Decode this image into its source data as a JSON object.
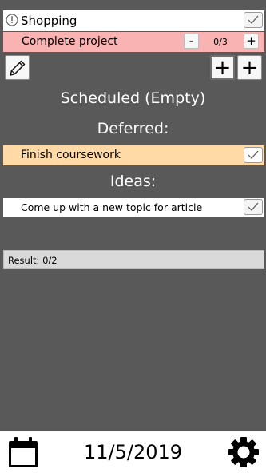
{
  "list_item": {
    "label": "Shopping",
    "icon": "info-icon",
    "checked": true
  },
  "project": {
    "label": "Complete project",
    "minus_label": "-",
    "progress_text": "0/3",
    "plus_label": "+",
    "bg_color": "#f9b3b3"
  },
  "toolbar": {
    "edit_icon": "pencil-icon",
    "add_label_1": "+",
    "add_label_2": "+"
  },
  "sections": {
    "scheduled_title": "Scheduled (Empty)",
    "deferred_title": "Deferred:",
    "ideas_title": "Ideas:"
  },
  "deferred_items": [
    {
      "label": "Finish coursework",
      "checked": true,
      "bg_color": "#ffd9a6"
    }
  ],
  "idea_items": [
    {
      "label": "Come up with a new topic for article",
      "checked": true
    }
  ],
  "result": {
    "text": "Result: 0/2"
  },
  "footer": {
    "date": "11/5/2019",
    "calendar_icon": "calendar-icon",
    "settings_icon": "gear-icon"
  }
}
